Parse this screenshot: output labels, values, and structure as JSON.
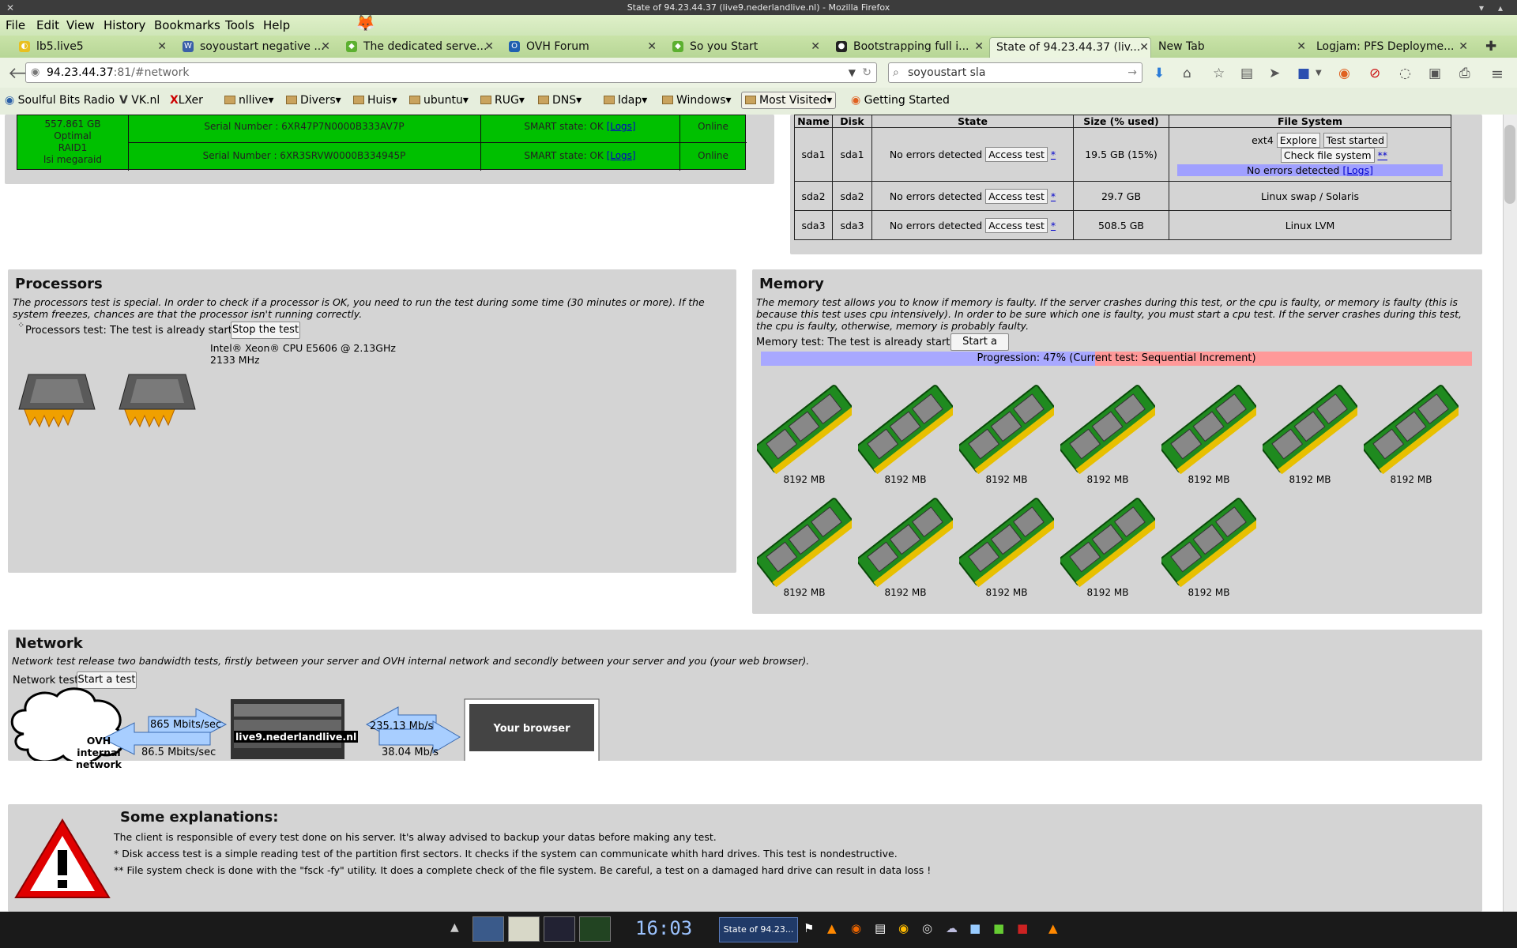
{
  "window": {
    "title": "State of 94.23.44.37 (live9.nederlandlive.nl) - Mozilla Firefox"
  },
  "menu": [
    "File",
    "Edit",
    "View",
    "History",
    "Bookmarks",
    "Tools",
    "Help"
  ],
  "tabs": [
    {
      "label": "lb5.live5",
      "color": "#e8c020"
    },
    {
      "label": "soyoustart negative ...",
      "color": "#3a5fa8"
    },
    {
      "label": "The dedicated serve...",
      "color": "#5cb030"
    },
    {
      "label": "OVH Forum",
      "color": "#2060b0"
    },
    {
      "label": "So you Start",
      "color": "#5cb030"
    },
    {
      "label": "Bootstrapping full i...",
      "color": "#222"
    },
    {
      "label": "State of 94.23.44.37 (liv...",
      "color": "#888"
    },
    {
      "label": "New Tab",
      "color": "#888"
    },
    {
      "label": "Logjam: PFS Deployme...",
      "color": "#e06020"
    }
  ],
  "nav": {
    "url_host": "94.23.44.37",
    "url_rest": ":81/#network",
    "search": "soyoustart sla"
  },
  "bookmarks": [
    {
      "label": "Soulful Bits Radio",
      "folder": false
    },
    {
      "label": "VK.nl",
      "folder": false
    },
    {
      "label": "LXer",
      "folder": false
    },
    {
      "label": "nllive",
      "folder": true
    },
    {
      "label": "Divers",
      "folder": true
    },
    {
      "label": "Huis",
      "folder": true
    },
    {
      "label": "ubuntu",
      "folder": true
    },
    {
      "label": "RUG",
      "folder": true
    },
    {
      "label": "DNS",
      "folder": true
    },
    {
      "label": "ldap",
      "folder": true
    },
    {
      "label": "Windows",
      "folder": true
    },
    {
      "label": "Most Visited",
      "folder": true
    },
    {
      "label": "Getting Started",
      "folder": false
    }
  ],
  "raid": {
    "size": "557.861 GB",
    "status": "Optimal",
    "level": "RAID1",
    "controller": "lsi megaraid",
    "disks": [
      {
        "serial": "Serial Number : 6XR47P7N0000B333AV7P",
        "smart": "SMART state: OK",
        "logs": "[Logs]",
        "state": "Online"
      },
      {
        "serial": "Serial Number : 6XR3SRVW0000B334945P",
        "smart": "SMART state: OK",
        "logs": "[Logs]",
        "state": "Online"
      }
    ]
  },
  "partitions": {
    "headers": [
      "Name",
      "Disk",
      "State",
      "Size (% used)",
      "File System"
    ],
    "rows": [
      {
        "name": "sda1",
        "disk": "sda1",
        "state": "No errors detected",
        "btn": "Access test",
        "star": "*",
        "size": "19.5 GB (15%)",
        "fs": "ext4",
        "explore": "Explore",
        "started": "Test started",
        "check": "Check file system",
        "dstar": "**",
        "fs_result": "No errors detected",
        "fs_logs": "[Logs]"
      },
      {
        "name": "sda2",
        "disk": "sda2",
        "state": "No errors detected",
        "btn": "Access test",
        "star": "*",
        "size": "29.7 GB",
        "fs": "Linux swap / Solaris"
      },
      {
        "name": "sda3",
        "disk": "sda3",
        "state": "No errors detected",
        "btn": "Access test",
        "star": "*",
        "size": "508.5 GB",
        "fs": "Linux LVM"
      }
    ]
  },
  "processors": {
    "title": "Processors",
    "desc": "The processors test is special. In order to check if a processor is OK, you need to run the test during some time (30 minutes or more). If the system freezes, chances are that the processor isn't running correctly.",
    "status": "Processors test: The test is already started",
    "button": "Stop the test",
    "model": "Intel® Xeon® CPU E5606 @ 2.13GHz",
    "freq": "2133 MHz"
  },
  "memory": {
    "title": "Memory",
    "desc": "The memory test allows you to know if memory is faulty. If the server crashes during this test, or the cpu is faulty, or memory is faulty (this is because this test uses cpu intensively). In order to be sure which one is faulty, you must start a cpu test. If the server crashes during this test, the cpu is faulty, otherwise, memory is probably faulty.",
    "status": "Memory test: The test is already started",
    "button": "Start a test",
    "progress_text": "Progression: 47% (Current test: Sequential Increment)",
    "progress": 0.47,
    "modules": [
      "8192 MB",
      "8192 MB",
      "8192 MB",
      "8192 MB",
      "8192 MB",
      "8192 MB",
      "8192 MB",
      "8192 MB",
      "8192 MB",
      "8192 MB",
      "8192 MB",
      "8192 MB"
    ]
  },
  "network": {
    "title": "Network",
    "desc": "Network test release two bandwidth tests, firstly between your server and OVH internal network and secondly between your server and you (your web browser).",
    "label": "Network test",
    "button": "Start a test",
    "cloud1": "OVH",
    "cloud2": "internal network",
    "up": "865 Mbits/sec",
    "down": "86.5 Mbits/sec",
    "server": "live9.nederlandlive.nl",
    "b_in": "235.13 Mb/s",
    "b_out": "38.04 Mb/s",
    "browser": "Your browser"
  },
  "explanations": {
    "title": "Some explanations:",
    "lines": [
      "The client is responsible of every test done on his server. It's alway advised to backup your datas before making any test.",
      "* Disk access test is a simple reading test of the partition first sectors. It checks if the system can communicate whith hard drives. This test is nondestructive.",
      "** File system check is done with the \"fsck -fy\" utility. It does a complete check of the file system. Be careful, a test on a damaged hard drive can result in data loss !"
    ]
  },
  "taskbar": {
    "clock": "16:03",
    "task": "State of 94.23..."
  }
}
